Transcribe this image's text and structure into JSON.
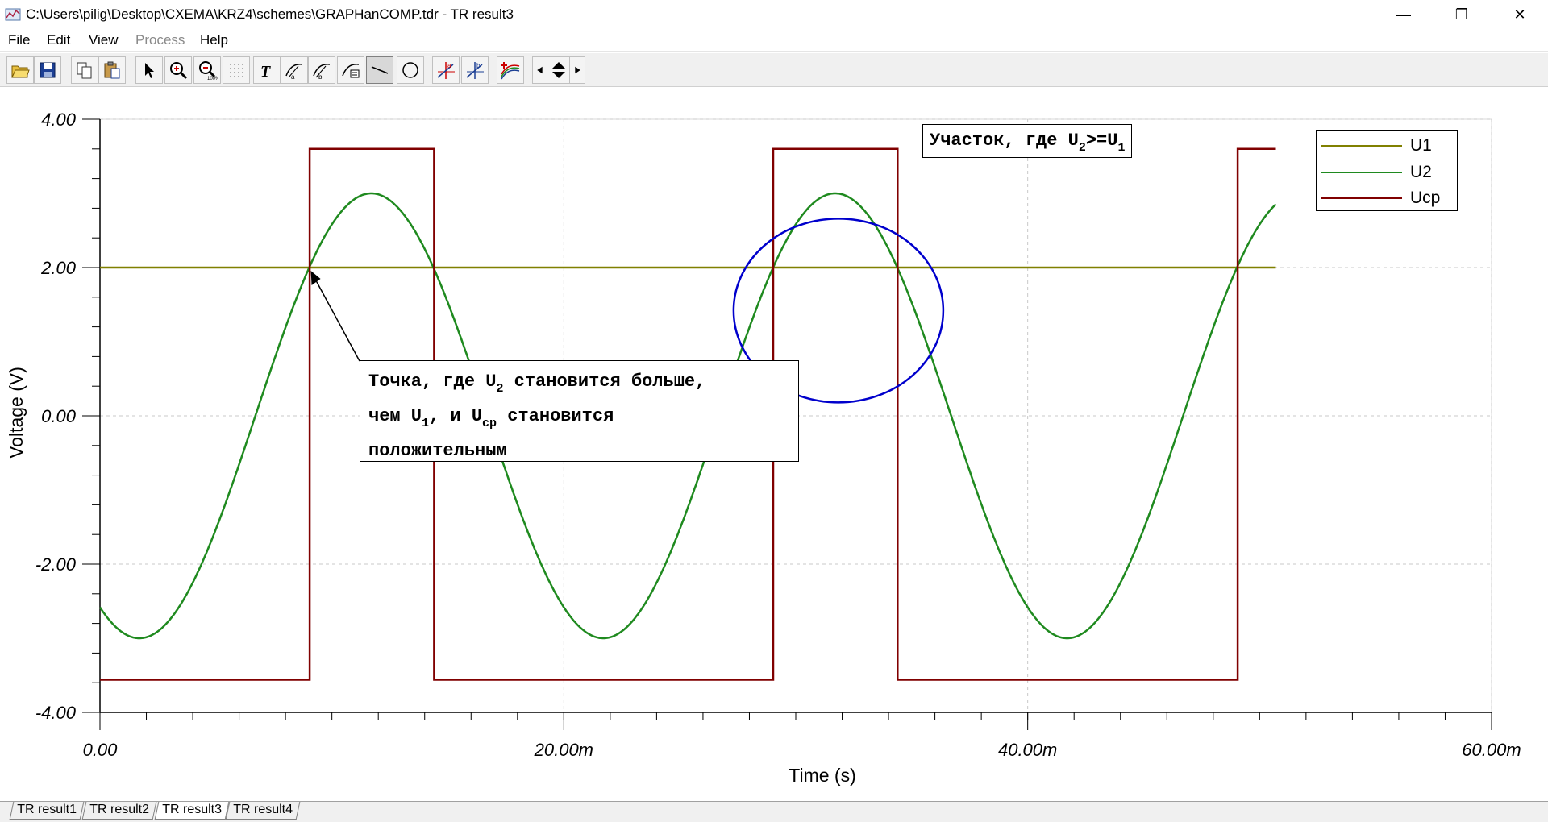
{
  "window": {
    "title": "C:\\Users\\pilig\\Desktop\\CXEMA\\KRZ4\\schemes\\GRAPHanCOMP.tdr - TR result3",
    "controls": {
      "minimize": "—",
      "maximize": "❐",
      "close": "✕"
    }
  },
  "menu": {
    "file": "File",
    "edit": "Edit",
    "view": "View",
    "process": "Process",
    "help": "Help"
  },
  "toolbar": {
    "icons": [
      "open-folder-icon",
      "save-icon",
      "copy-icon",
      "paste-icon",
      "select-arrow-icon",
      "zoom-in-icon",
      "zoom-100-icon",
      "grid-icon",
      "text-tool-icon",
      "cursor-a-icon",
      "cursor-b-icon",
      "curve-label-icon",
      "line-tool-icon",
      "ellipse-tool-icon",
      "marker-a-icon",
      "marker-b-icon",
      "multi-curve-icon",
      "scroll-left-icon",
      "scroll-vertical-icon",
      "scroll-right-icon"
    ],
    "pressed": "line-tool-icon"
  },
  "chart_data": {
    "type": "line",
    "xlabel": "Time (s)",
    "ylabel": "Voltage (V)",
    "xlim": [
      0,
      0.06
    ],
    "ylim": [
      -4,
      4
    ],
    "xticks": [
      0,
      0.02,
      0.04,
      0.06
    ],
    "xtick_labels": [
      "0.00",
      "20.00m",
      "40.00m",
      "60.00m"
    ],
    "yticks": [
      4,
      2,
      0,
      -2,
      -4
    ],
    "ytick_labels": [
      "4.00",
      "2.00",
      "0.00",
      "-2.00",
      "-4.00"
    ],
    "grid": "dashed",
    "legend_position": "top-right",
    "colors": {
      "U1": "#808000",
      "U2": "#1f8a1f",
      "Ucp": "#800000"
    },
    "series": [
      {
        "name": "U1",
        "type": "constant",
        "value": 2.0,
        "x_range": [
          0,
          0.0507
        ]
      },
      {
        "name": "U2",
        "type": "sine",
        "offset": 0.0,
        "amplitude": 3.0,
        "period": 0.02,
        "x_at_minimum": 0.0017,
        "x_range": [
          0,
          0.0507
        ]
      },
      {
        "name": "Ucp",
        "type": "comparator",
        "high": 3.6,
        "low": -3.56,
        "threshold_series": "U1",
        "input_series": "U2",
        "x_range": [
          0,
          0.0507
        ]
      }
    ]
  },
  "legend": {
    "items": [
      {
        "label": "U1",
        "color": "#808000"
      },
      {
        "label": "U2",
        "color": "#1f8a1f"
      },
      {
        "label": "Ucp",
        "color": "#800000"
      }
    ]
  },
  "annotations": {
    "region": {
      "text_a": "Участок, где U",
      "sub_a": "2",
      "text_b": ">=U",
      "sub_b": "1"
    },
    "point": {
      "line1_a": "Точка, где U",
      "line1_sub": "2",
      "line1_b": " становится больше,",
      "line2_a": "чем U",
      "line2_sub1": "1",
      "line2_b": ", и U",
      "line2_sub2": "cp",
      "line2_c": " становится",
      "line3": "положительным"
    },
    "circle_color": "#0000cc"
  },
  "tabs": [
    "TR result1",
    "TR result2",
    "TR result3",
    "TR result4"
  ],
  "active_tab": "TR result3"
}
